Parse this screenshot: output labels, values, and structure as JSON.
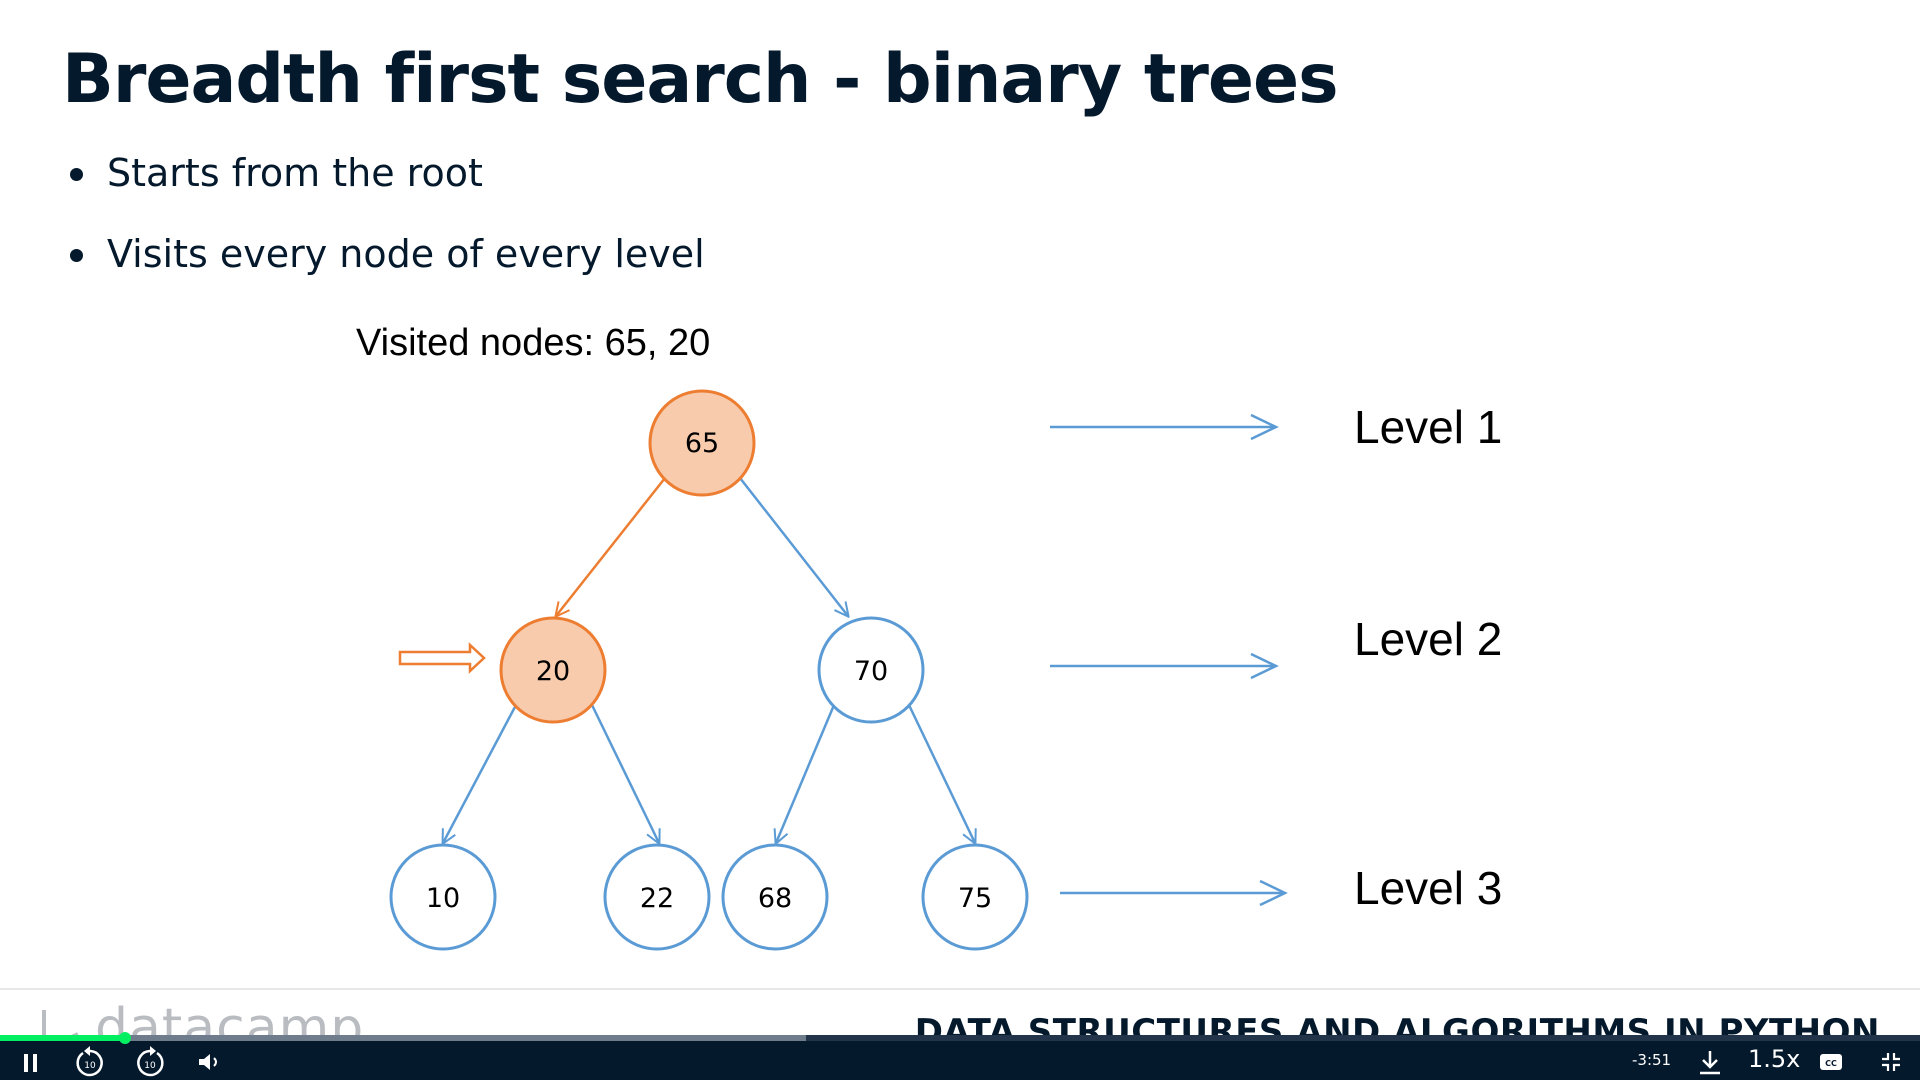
{
  "slide": {
    "title": "Breadth first search - binary trees",
    "bullets": [
      "Starts from the root",
      "Visits every node of every level"
    ],
    "visited_text": "Visited nodes: 65, 20",
    "levels": [
      "Level 1",
      "Level 2",
      "Level 3"
    ],
    "nodes": [
      {
        "id": "n65",
        "value": "65",
        "visited": true
      },
      {
        "id": "n20",
        "value": "20",
        "visited": true
      },
      {
        "id": "n70",
        "value": "70",
        "visited": false
      },
      {
        "id": "n10",
        "value": "10",
        "visited": false
      },
      {
        "id": "n22",
        "value": "22",
        "visited": false
      },
      {
        "id": "n68",
        "value": "68",
        "visited": false
      },
      {
        "id": "n75",
        "value": "75",
        "visited": false
      }
    ],
    "edges": [
      [
        "n65",
        "n20"
      ],
      [
        "n65",
        "n70"
      ],
      [
        "n20",
        "n10"
      ],
      [
        "n20",
        "n22"
      ],
      [
        "n70",
        "n68"
      ],
      [
        "n70",
        "n75"
      ]
    ],
    "current_node": "n20",
    "colors": {
      "visited_fill": "#f8cbad",
      "visited_stroke": "#ed7d31",
      "unvisited_stroke": "#5b9bd5"
    }
  },
  "footer": {
    "brand": "datacamp",
    "course": "DATA STRUCTURES AND ALGORITHMS IN PYTHON"
  },
  "player": {
    "progress": 0.065,
    "buffered": 0.42,
    "time_remaining": "-3:51",
    "speed": "1.5x",
    "icons": {
      "pause": "pause-icon",
      "rewind": "rewind-10-icon",
      "forward": "forward-10-icon",
      "volume": "volume-icon",
      "download": "download-icon",
      "captions": "captions-icon",
      "exit_fullscreen": "exit-fullscreen-icon"
    },
    "rewind_seconds": "10",
    "forward_seconds": "10",
    "captions_label": "CC"
  }
}
